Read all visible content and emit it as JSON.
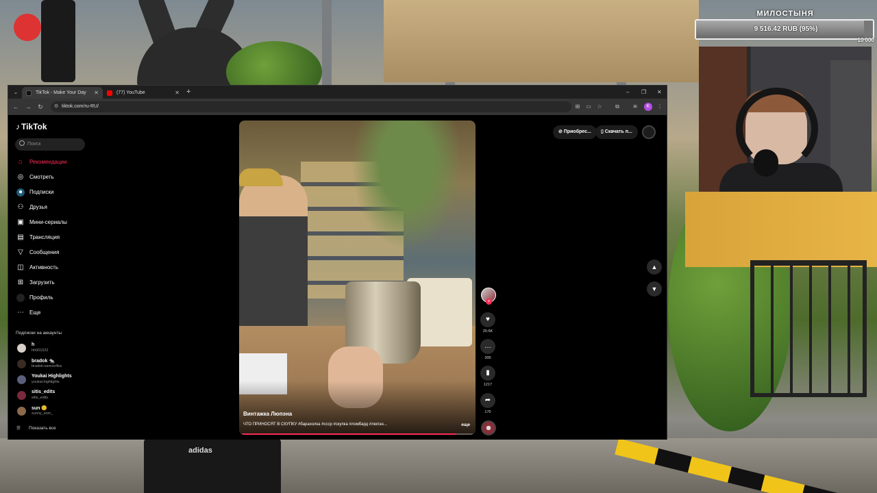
{
  "donation": {
    "title": "МИЛОСТЫНЯ",
    "amount": "9 516.42 RUB (95%)",
    "goal": "10 000",
    "progress_percent": 95
  },
  "browser": {
    "tabs": [
      {
        "title": "TikTok - Make Your Day",
        "active": true
      },
      {
        "title": "(77) YouTube",
        "active": false
      }
    ],
    "url": "tiktok.com/ru-RU/",
    "profile_initial": "K"
  },
  "tiktok": {
    "logo": "TikTok",
    "search_placeholder": "Поиск",
    "nav": [
      {
        "label": "Рекомендации",
        "icon": "home-icon",
        "active": true
      },
      {
        "label": "Смотреть",
        "icon": "compass-icon",
        "active": false
      },
      {
        "label": "Подписки",
        "icon": "following-icon",
        "active": false
      },
      {
        "label": "Друзья",
        "icon": "friends-icon",
        "active": false
      },
      {
        "label": "Мини-сериалы",
        "icon": "series-icon",
        "active": false
      },
      {
        "label": "Трансляция",
        "icon": "live-icon",
        "active": false
      },
      {
        "label": "Сообщения",
        "icon": "messages-icon",
        "active": false
      },
      {
        "label": "Активность",
        "icon": "activity-icon",
        "active": false
      },
      {
        "label": "Загрузить",
        "icon": "upload-icon",
        "active": false
      },
      {
        "label": "Профиль",
        "icon": "profile-icon",
        "active": false
      },
      {
        "label": "Еще",
        "icon": "more-icon",
        "active": false
      }
    ],
    "following_section_label": "Подписки на аккаунты",
    "accounts": [
      {
        "name": "h",
        "handle": "hh001022"
      },
      {
        "name": "bradok 🐀",
        "handle": "bradok.narezo4ka"
      },
      {
        "name": "Youkai Highlights",
        "handle": "youkai.highlights"
      },
      {
        "name": "sitis_edits",
        "handle": "sitis_edits"
      },
      {
        "name": "sun 😊",
        "handle": "sunny_som_"
      }
    ],
    "show_all": "Показать все",
    "top_buttons": {
      "purchase": "Приобрес...",
      "download": "Скачать п..."
    },
    "video": {
      "author": "Винтажка Люпэна",
      "caption": "ЧТО ПРИНОСЯТ В СКУПКУ #барахолка #ссср #скупка #ломбард #люпэн...",
      "more": "еще",
      "progress_percent": 92
    },
    "actions": {
      "likes": "20.6K",
      "comments": "300",
      "saves": "1217",
      "shares": "170"
    }
  }
}
